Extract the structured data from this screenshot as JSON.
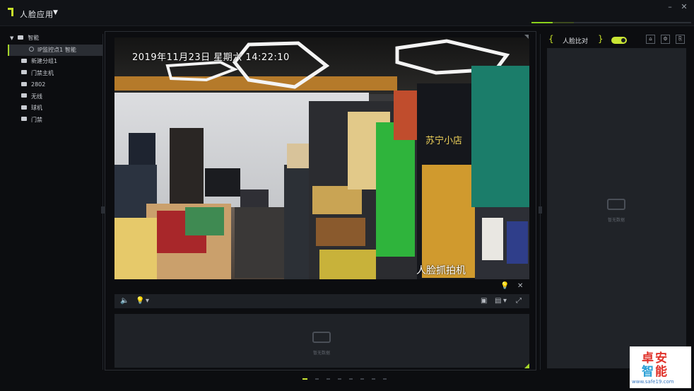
{
  "app": {
    "title": "人脸应用",
    "caret": "▼"
  },
  "window": {
    "minimize": "–",
    "close": "✕"
  },
  "tree": {
    "root": {
      "label": "智能",
      "caret": "▼"
    },
    "camera": {
      "label": "IP监控点1 智能"
    },
    "folders": [
      {
        "label": "新建分组1"
      },
      {
        "label": "门禁主机"
      },
      {
        "label": "2802"
      },
      {
        "label": "无线"
      },
      {
        "label": "球机"
      },
      {
        "label": "门禁"
      }
    ]
  },
  "video": {
    "timestamp": "2019年11月23日  星期六  14:22:10",
    "overlay_label": "人脸抓拍机",
    "store_sign": "苏宁小店"
  },
  "video_controls": {
    "volume_icon": "🔈",
    "light_icon": "💡",
    "caret": "▾",
    "snapshot_icon": "▣",
    "layout_icon": "▤",
    "fullscreen_icon": "⤢"
  },
  "bottom_panel": {
    "empty_label": "暂无数据"
  },
  "right_panel": {
    "title": "人脸比对",
    "bracket_left": "{",
    "bracket_right": "}",
    "toggle_on": true,
    "empty_label": "暂无数据",
    "btn1": "⌂",
    "btn2": "⚙",
    "btn3": "⎘"
  },
  "watermark": {
    "line1": "卓安",
    "line2": "智能",
    "url": "www.safe19.com"
  },
  "colors": {
    "accent": "#a5d62a",
    "toggle": "#c9e534",
    "panel": "#202328",
    "background": "#0c0d10"
  }
}
